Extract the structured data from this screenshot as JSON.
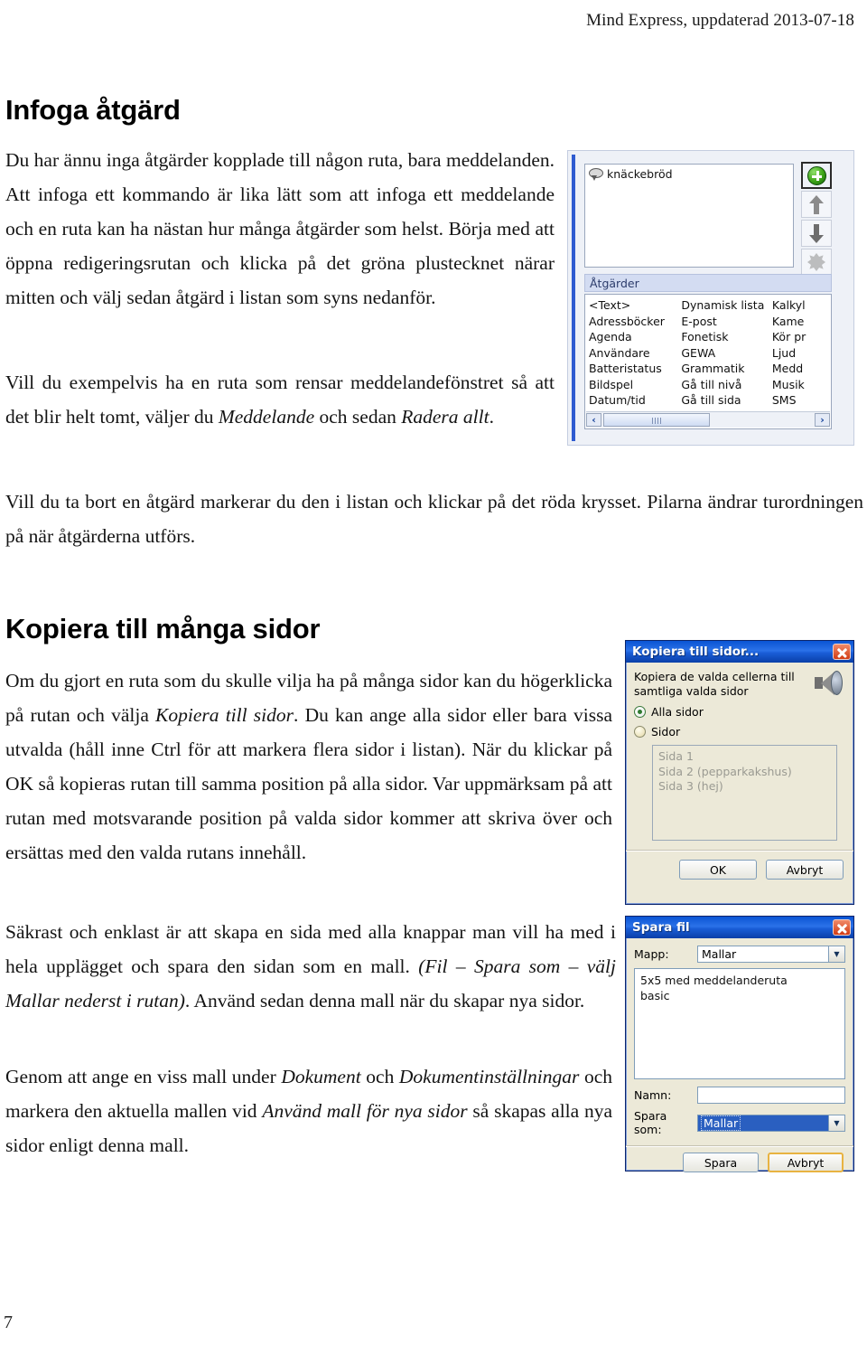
{
  "header": {
    "running_head": "Mind Express, uppdaterad 2013-07-18"
  },
  "page_number": "7",
  "sections": {
    "infoga": {
      "heading": "Infoga åtgärd",
      "p1_a": "Du har ännu inga åtgärder kopplade till någon ruta, bara meddelanden. Att infoga ett kommando är lika lätt som att infoga ett meddelande och en ruta kan ha nästan hur många åtgärder som helst. Börja med att öppna redigeringsrutan och klicka på det gröna plustecknet närar mitten och välj sedan åtgärd i listan som syns nedanför.",
      "p2_a": "Vill du exempelvis ha en ruta som rensar meddelandefönstret så att det blir helt tomt, väljer du ",
      "p2_i1": "Meddelande",
      "p2_b": " och sedan ",
      "p2_i2": "Radera allt",
      "p2_c": ".",
      "p3": "Vill du ta bort en åtgärd markerar du den i listan och klickar på det röda krysset. Pilarna ändrar turordningen på när åtgärderna utförs."
    },
    "kopiera": {
      "heading": "Kopiera till många sidor",
      "p4_a": "Om du gjort en ruta som du skulle vilja ha på många sidor kan du högerklicka på rutan och välja ",
      "p4_i1": "Kopiera till sidor",
      "p4_b": ". Du kan ange alla sidor eller bara vissa utvalda (håll inne Ctrl för att markera flera sidor i listan). När du klickar på OK så kopieras rutan till samma position på alla sidor. Var uppmärksam på att rutan med motsvarande position på valda sidor kommer att skriva över och ersättas med den valda rutans innehåll.",
      "p5_a": "Säkrast och enklast är att skapa en sida med alla knappar man vill ha med i hela upplägget och spara den sidan som en mall. ",
      "p5_i1": "(Fil – Spara som – välj Mallar nederst i rutan)",
      "p5_b": ". Använd sedan denna mall när du skapar nya sidor.",
      "p6_a": "Genom att ange en viss mall under ",
      "p6_i1": "Dokument",
      "p6_b": " och ",
      "p6_i2": "Dokumentinställningar",
      "p6_c": " och markera den aktuella mallen vid ",
      "p6_i3": "Använd mall för nya sidor",
      "p6_d": " så skapas alla nya sidor enligt denna mall."
    }
  },
  "screenshot_actions_panel": {
    "message_list": [
      {
        "label": "knäckebröd",
        "icon": "speech-bubble-icon"
      }
    ],
    "buttons": [
      {
        "name": "add-action-button",
        "icon": "green-plus-icon"
      },
      {
        "name": "move-up-button",
        "icon": "arrow-up-icon"
      },
      {
        "name": "move-down-button",
        "icon": "arrow-down-icon"
      },
      {
        "name": "delete-action-button",
        "icon": "red-cross-icon-disabled"
      }
    ],
    "group_header": "Åtgärder",
    "action_columns": [
      [
        "<Text>",
        "Adressböcker",
        "Agenda",
        "Användare",
        "Batteristatus",
        "Bildspel",
        "Datum/tid"
      ],
      [
        "Dynamisk lista",
        "E-post",
        "Fonetisk",
        "GEWA",
        "Grammatik",
        "Gå till nivå",
        "Gå till sida"
      ],
      [
        "Kalkyl",
        "Kame",
        "Kör pr",
        "Ljud",
        "Medd",
        "Musik",
        "SMS"
      ]
    ],
    "scrollbar": {
      "left_arrow": "‹",
      "right_arrow": "›"
    }
  },
  "dialog_copy_to_pages": {
    "title": "Kopiera till sidor...",
    "close_label": "×",
    "description": "Kopiera de valda cellerna till samtliga valda sidor",
    "speaker_icon": "speaker-icon",
    "radio_all": "Alla sidor",
    "radio_some": "Sidor",
    "selected_radio": "Alla sidor",
    "page_list": [
      "Sida 1",
      "Sida 2 (pepparkakshus)",
      "Sida 3 (hej)"
    ],
    "ok_label": "OK",
    "cancel_label": "Avbryt"
  },
  "dialog_save_file": {
    "title": "Spara fil",
    "close_label": "×",
    "folder_label": "Mapp:",
    "folder_value": "Mallar",
    "file_list": [
      "5x5 med meddelanderuta",
      "basic"
    ],
    "name_label": "Namn:",
    "name_value": "",
    "save_as_label": "Spara som:",
    "save_as_value": "Mallar",
    "save_label": "Spara",
    "cancel_label": "Avbryt",
    "dropdown_glyph": "▼"
  },
  "colors": {
    "xp_title_blue": "#1a5ed8",
    "xp_face": "#ece9d8",
    "accent_green": "#3da318",
    "close_red": "#d23c14",
    "selection_blue": "#2a5fc0",
    "focus_yellow": "#e8b341",
    "panel_blue_bar": "#2f5bd0"
  }
}
